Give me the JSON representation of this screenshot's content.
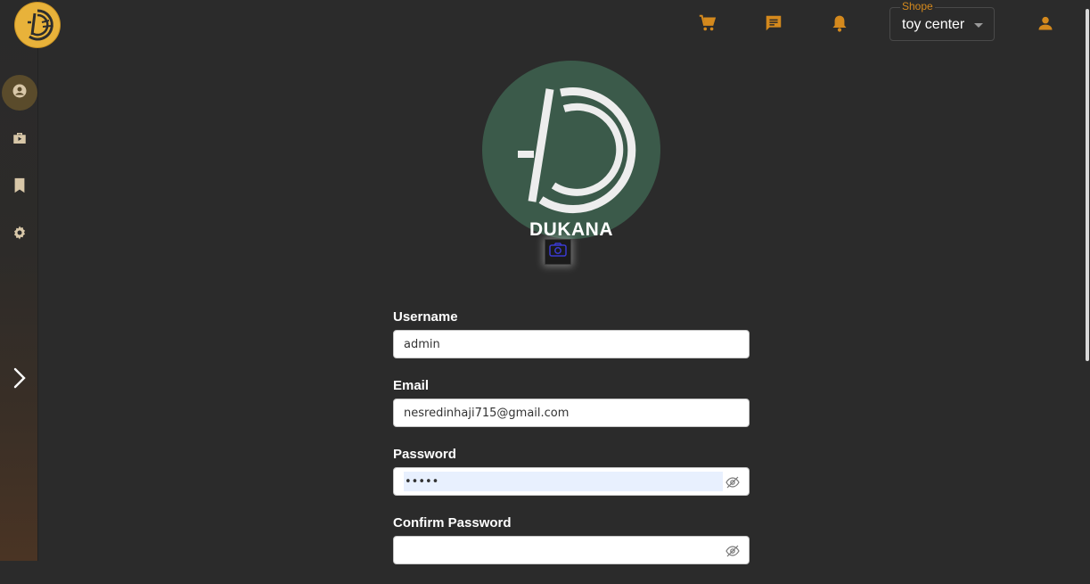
{
  "brand": {
    "logo_icon": "dukana-logo-icon",
    "avatar_text": "DUKANA",
    "accent_color": "#d4891d",
    "logo_color": "#e8b23a"
  },
  "sidebar": {
    "items": [
      {
        "name": "profile",
        "icon": "account-circle-icon",
        "active": true
      },
      {
        "name": "shop",
        "icon": "shopping-bag-icon",
        "active": false
      },
      {
        "name": "saved",
        "icon": "bookmark-icon",
        "active": false
      },
      {
        "name": "settings",
        "icon": "gear-icon",
        "active": false
      }
    ],
    "expand_icon": "chevron-right-icon"
  },
  "topbar": {
    "icons": [
      "cart-icon",
      "message-icon",
      "bell-icon",
      "user-icon"
    ],
    "shop_select": {
      "legend": "Shope",
      "value": "toy center"
    }
  },
  "profile": {
    "camera_icon": "camera-icon"
  },
  "form": {
    "username": {
      "label": "Username",
      "value": "admin"
    },
    "email": {
      "label": "Email",
      "value": "nesredinhaji715@gmail.com"
    },
    "password": {
      "label": "Password",
      "value": "•••••"
    },
    "confirm_password": {
      "label": "Confirm Password",
      "value": ""
    },
    "visibility_icon": "eye-off-icon"
  }
}
